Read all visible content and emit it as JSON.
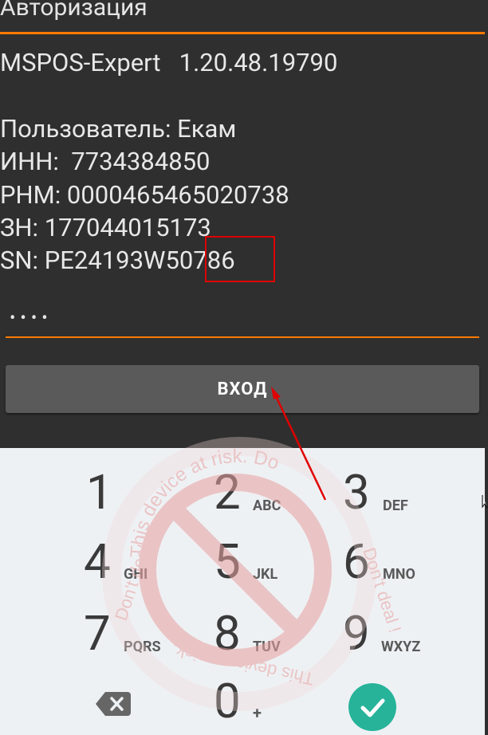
{
  "dialog": {
    "title": "Авторизация",
    "version_line": "MSPOS-Expert   1.20.48.19790",
    "user_line": "Пользователь: Екам",
    "inn_line": "ИНН:  7734384850",
    "rnm_line": "РНМ: 0000465465020738",
    "zn_line": "ЗН: 177044015173",
    "sn_line": "SN: PE24193W50786",
    "password_masked": "••••",
    "login_label": "ВХОД"
  },
  "keypad": {
    "keys": [
      {
        "digit": "1",
        "letters": ""
      },
      {
        "digit": "2",
        "letters": "ABC"
      },
      {
        "digit": "3",
        "letters": "DEF"
      },
      {
        "digit": "4",
        "letters": "GHI"
      },
      {
        "digit": "5",
        "letters": "JKL"
      },
      {
        "digit": "6",
        "letters": "MNO"
      },
      {
        "digit": "7",
        "letters": "PQRS"
      },
      {
        "digit": "8",
        "letters": "TUV"
      },
      {
        "digit": "9",
        "letters": "WXYZ"
      },
      {
        "digit": "0",
        "letters": "+"
      }
    ],
    "backspace_icon": "backspace-icon",
    "done_icon": "checkmark-icon"
  },
  "watermark": {
    "text_top": "This device at risk. Do",
    "text_left": "Don't deal !",
    "text_right": "Don't deal !",
    "text_bottom": "This device at risk."
  },
  "colors": {
    "accent": "#ff7a00",
    "background": "#2f2f2f",
    "keypad_bg": "#eef1f4",
    "done_button": "#26b39a",
    "annotation": "#e00000"
  }
}
